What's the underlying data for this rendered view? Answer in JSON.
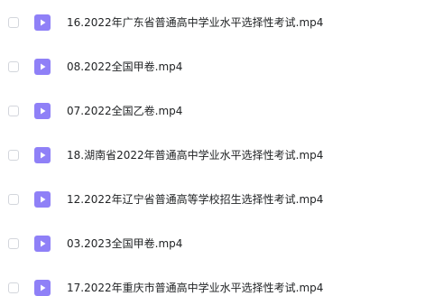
{
  "files": [
    {
      "name": "16.2022年广东省普通高中学业水平选择性考试.mp4",
      "icon": "video-file-icon"
    },
    {
      "name": "08.2022全国甲卷.mp4",
      "icon": "video-file-icon"
    },
    {
      "name": "07.2022全国乙卷.mp4",
      "icon": "video-file-icon"
    },
    {
      "name": "18.湖南省2022年普通高中学业水平选择性考试.mp4",
      "icon": "video-file-icon"
    },
    {
      "name": "12.2022年辽宁省普通高等学校招生选择性考试.mp4",
      "icon": "video-file-icon"
    },
    {
      "name": "03.2023全国甲卷.mp4",
      "icon": "video-file-icon"
    },
    {
      "name": "17.2022年重庆市普通高中学业水平选择性考试.mp4",
      "icon": "video-file-icon"
    }
  ],
  "colors": {
    "icon_background": "#8f80f7",
    "text": "#222426",
    "checkbox_border": "#d3d6dc"
  }
}
